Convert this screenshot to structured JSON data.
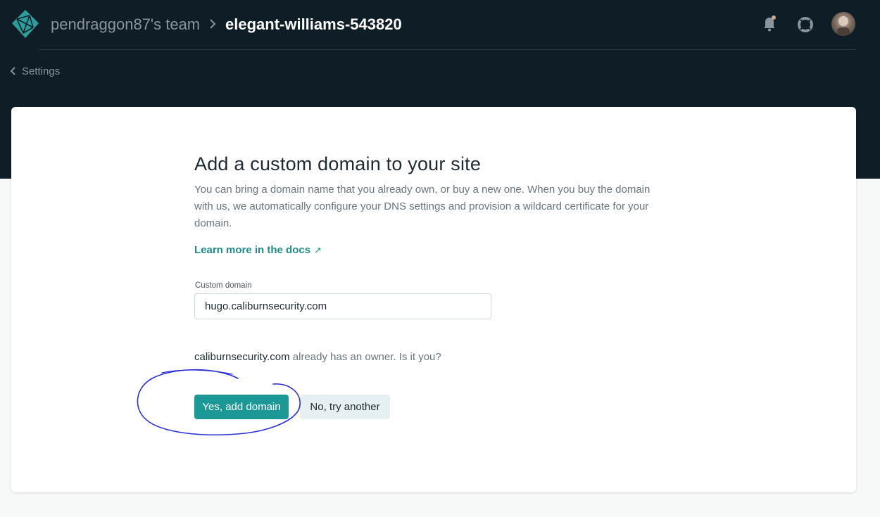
{
  "header": {
    "team_name": "pendraggon87's team",
    "site_name": "elegant-williams-543820",
    "icons": [
      "netlify-logo-icon",
      "chevron-right-icon",
      "bell-icon",
      "help-lifebuoy-icon",
      "user-avatar"
    ]
  },
  "nav": {
    "back_label": "Settings"
  },
  "main": {
    "title": "Add a custom domain to your site",
    "description": "You can bring a domain name that you already own, or buy a new one. When you buy the domain with us, we automatically configure your DNS settings and provision a wildcard certificate for your domain.",
    "docs_link": "Learn more in the docs",
    "docs_link_icon": "↗",
    "field_label": "Custom domain",
    "field_value": "hugo.caliburnsecurity.com",
    "owner_domain": "caliburnsecurity.com",
    "owner_question": " already has an owner. Is it you?",
    "yes_button": "Yes, add domain",
    "no_button": "No, try another"
  },
  "colors": {
    "header_bg": "#0f1e26",
    "accent_teal": "#1c9896",
    "link_teal": "#1f8b87",
    "annotation_blue": "#2a2fd6"
  }
}
